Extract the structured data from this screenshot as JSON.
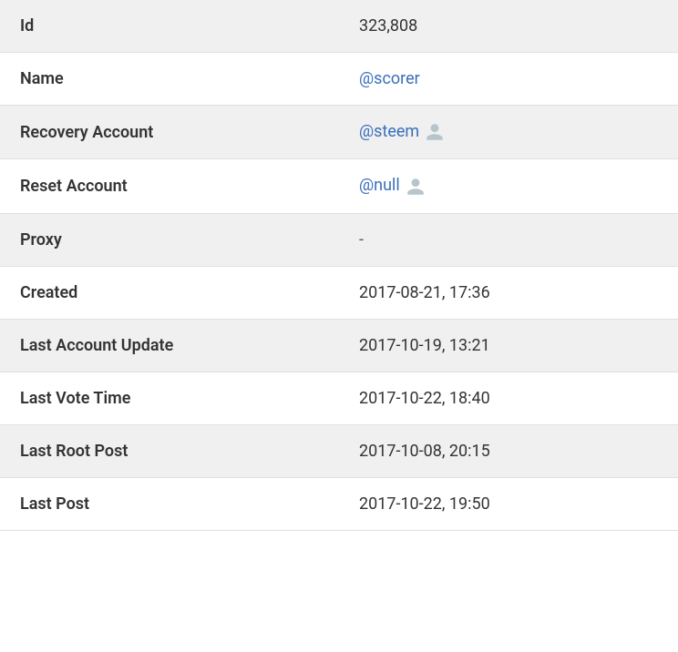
{
  "rows": [
    {
      "label": "Id",
      "value": "323,808",
      "type": "text"
    },
    {
      "label": "Name",
      "value": "@scorer",
      "type": "link"
    },
    {
      "label": "Recovery Account",
      "value": "@steem",
      "type": "link-icon"
    },
    {
      "label": "Reset Account",
      "value": "@null",
      "type": "link-icon"
    },
    {
      "label": "Proxy",
      "value": "-",
      "type": "dash"
    },
    {
      "label": "Created",
      "value": "2017-08-21, 17:36",
      "type": "text"
    },
    {
      "label": "Last Account Update",
      "value": "2017-10-19, 13:21",
      "type": "text"
    },
    {
      "label": "Last Vote Time",
      "value": "2017-10-22, 18:40",
      "type": "text"
    },
    {
      "label": "Last Root Post",
      "value": "2017-10-08, 20:15",
      "type": "text"
    },
    {
      "label": "Last Post",
      "value": "2017-10-22, 19:50",
      "type": "text"
    }
  ]
}
